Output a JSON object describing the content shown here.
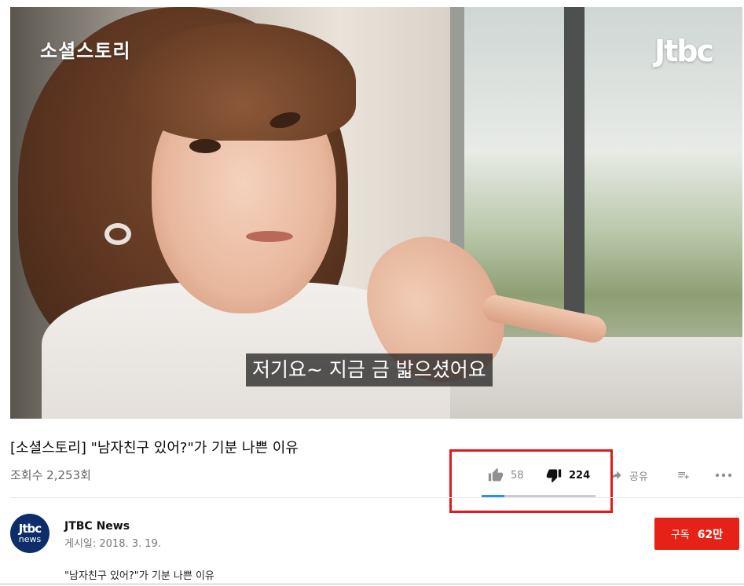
{
  "video": {
    "overlay_title": "소셜스토리",
    "logo": "JTBC",
    "logo_display": "Jtbc",
    "subtitle": "저기요~ 지금 금 밟으셨어요"
  },
  "info": {
    "title": "[소셜스토리] \"남자친구 있어?\"가 기분 나쁜 이유",
    "views": "조회수 2,253회"
  },
  "actions": {
    "like_count": "58",
    "dislike_count": "224",
    "share_label": "공유",
    "like_ratio": 0.2,
    "icons": [
      "thumbs-up-icon",
      "thumbs-down-icon",
      "share-icon",
      "add-to-playlist-icon",
      "more-icon"
    ]
  },
  "channel": {
    "avatar_line1": "Jtbc",
    "avatar_line2": "news",
    "name": "JTBC News",
    "published": "게시일: 2018. 3. 19.",
    "subscribe_label": "구독",
    "subscriber_count": "62만"
  },
  "description": "\"남자친구 있어?\"가 기분 나쁜 이유",
  "colors": {
    "subscribe": "#e62117",
    "highlight": "#e1191f",
    "sentiment_like": "#2793e6",
    "channel_avatar": "#0d2d6b"
  }
}
